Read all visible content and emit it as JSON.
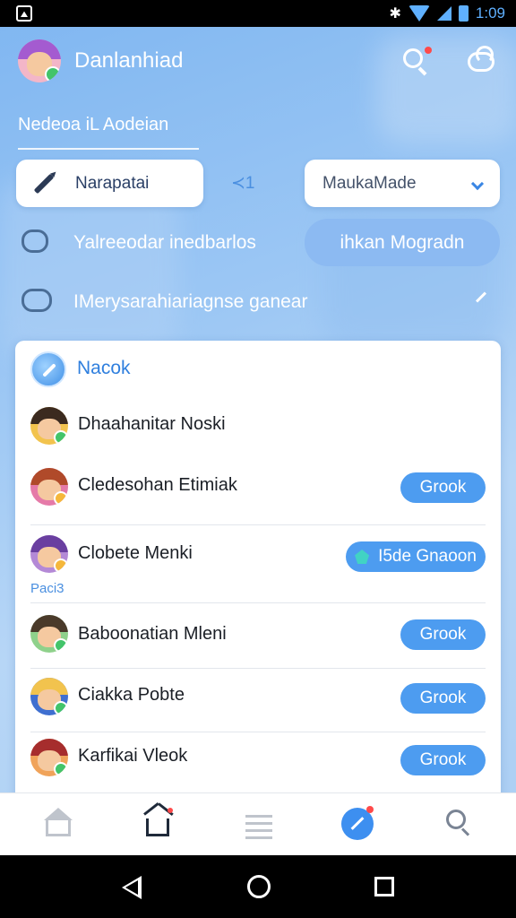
{
  "status_bar": {
    "time": "1:09"
  },
  "header": {
    "app_title": "Danlanhiad",
    "subtitle": "Nedeoa iL Aodeian"
  },
  "controls": {
    "edit_label": "Narapatai",
    "share_count": "1",
    "dropdown_value": "MaukaMade"
  },
  "rows": {
    "row1_text": "Yalreeodar inedbarlos",
    "row1_button": "ihkan Mogradn",
    "row2_text": "IMerysarahiariagnse ganear"
  },
  "card": {
    "title": "Nacok",
    "people": [
      {
        "name": "Dhaahanitar Noski",
        "button": ""
      },
      {
        "name": "Cledesohan Etimiak",
        "button": "Grook"
      },
      {
        "name": "Clobete Menki",
        "button": "I5de Gnaoon",
        "tag": "Paci3"
      },
      {
        "name": "Baboonatian Mleni",
        "button": "Grook"
      },
      {
        "name": "Ciakka Pobte",
        "button": "Grook"
      },
      {
        "name": "Karfikai Vleok",
        "button": "Grook"
      }
    ]
  },
  "icons": {
    "header_search": "search-icon",
    "header_cloud": "cloud-icon",
    "nav": [
      "home-outline-icon",
      "home-icon",
      "list-icon",
      "compose-icon",
      "search-icon"
    ]
  },
  "colors": {
    "accent": "#4d9cf0",
    "title_blue": "#2f7fde",
    "background": "#9cc7f4"
  }
}
